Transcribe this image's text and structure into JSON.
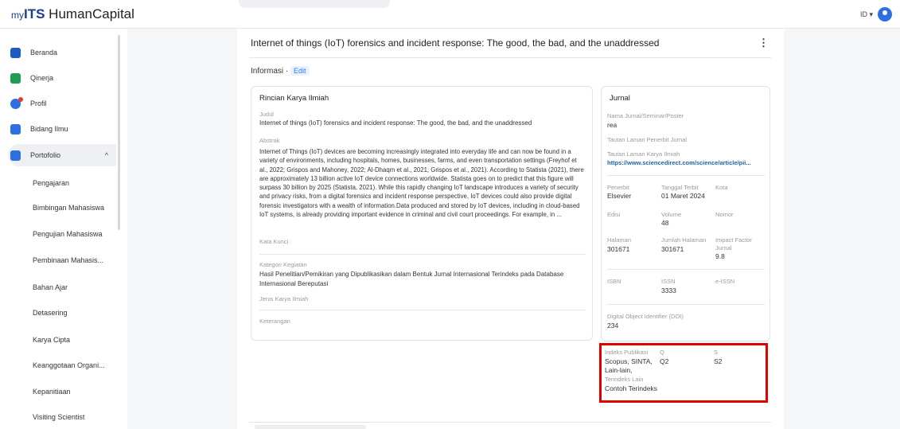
{
  "header": {
    "logo_prefix": "my",
    "logo_its": "ITS",
    "logo_suffix": " HumanCapital",
    "lang": "ID ▾"
  },
  "sidebar": {
    "items": [
      {
        "label": "Beranda",
        "icon": "home-icon",
        "color": "#1e5bbf"
      },
      {
        "label": "Qinerja",
        "icon": "chart-icon",
        "color": "#1f9d55"
      },
      {
        "label": "Profil",
        "icon": "profile-icon",
        "color": "#2f6fe0"
      },
      {
        "label": "Bidang Ilmu",
        "icon": "book-icon",
        "color": "#2f6fe0"
      },
      {
        "label": "Portofolio",
        "icon": "portfolio-icon",
        "color": "#2f6fe0",
        "chevron": "^"
      }
    ],
    "sub_items": [
      "Pengajaran",
      "Bimbingan Mahasiswa",
      "Pengujian Mahasiswa",
      "Pembinaan Mahasis...",
      "Bahan Ajar",
      "Detasering",
      "Karya Cipta",
      "Keanggotaan Organi...",
      "Kepanitiaan",
      "Visiting Scientist"
    ]
  },
  "main": {
    "title": "Internet of things (IoT) forensics and incident response: The good, the bad, and the unaddressed",
    "kebab": "⋮",
    "info_label": "Informasi",
    "info_sep": "·",
    "edit_label": "Edit",
    "left_card": {
      "title": "Rincian Karya Ilmiah",
      "judul_label": "Judul",
      "judul_value": "Internet of things (IoT) forensics and incident response: The good, the bad, and the unaddressed",
      "abstrak_label": "Abstrak",
      "abstrak_value": "Internet of Things (IoT) devices are becoming increasingly integrated into everyday life and can now be found in a variety of environments, including hospitals, homes, businesses, farms, and even transportation settings (Freyhof et al., 2022; Grispos and Mahoney, 2022; Al-Dhaqm et al., 2021; Grispos et al., 2021). According to Statista (2021), there are approximately 13 billion active IoT device connections worldwide. Statista goes on to predict that this figure will surpass 30 billion by 2025 (Statista, 2021). While this rapidly changing IoT landscape introduces a variety of security and privacy risks, from a digital forensics and incident response perspective, IoT devices could also provide digital forensic investigators with a wealth of information.Data produced and stored by IoT devices, including in cloud-based IoT systems, is already providing important evidence in criminal and civil court proceedings. For example, in ...",
      "kata_kunci_label": "Kata Kunci",
      "kategori_label": "Kategori Kegiatan",
      "kategori_value": "Hasil Penelitian/Pemikiran yang Dipublikasikan dalam Bentuk Jurnal Internasional Terindeks pada Database Internasional Bereputasi",
      "jenis_label": "Jenis Karya Ilmiah",
      "keterangan_label": "Keterangan"
    },
    "right_card": {
      "title": "Jurnal",
      "nama_label": "Nama Jurnal/Seminar/Poster",
      "nama_value": "rea",
      "tautan_penerbit_label": "Tautan Laman Penerbit Jurnal",
      "tautan_karya_label": "Tautan Laman Karya Ilmiah",
      "tautan_karya_value": "https://www.sciencedirect.com/science/article/pii...",
      "penerbit_label": "Penerbit",
      "penerbit_value": "Elsevier",
      "tanggal_label": "Tanggal Terbit",
      "tanggal_value": "01 Maret 2024",
      "kota_label": "Kota",
      "edisi_label": "Edisi",
      "volume_label": "Volume",
      "volume_value": "48",
      "nomor_label": "Nomor",
      "halaman_label": "Halaman",
      "halaman_value": "301671",
      "jumlah_label": "Jumlah Halaman",
      "jumlah_value": "301671",
      "impact_label_1": "Impact Factor",
      "impact_label_2": "Jurnal",
      "impact_value": "9.8",
      "isbn_label": "ISBN",
      "issn_label": "ISSN",
      "issn_value": "3333",
      "eissn_label": "e-ISSN",
      "doi_label": "Digital Object Identifier (DOI)",
      "doi_value": "234",
      "indeks_label": "Indeks Publikasi",
      "indeks_value_1": "Scopus, SINTA,",
      "indeks_value_2": "Lain-lain,",
      "q_label": "Q",
      "q_value": "Q2",
      "s_label": "S",
      "s_value": "S2",
      "terindeks_label": "Terindeks Lain",
      "terindeks_value": "Contoh Terindeks"
    }
  },
  "colors": {
    "accent": "#2b7de9",
    "highlight_box": "#e00000",
    "brand": "#1a3b8f"
  }
}
